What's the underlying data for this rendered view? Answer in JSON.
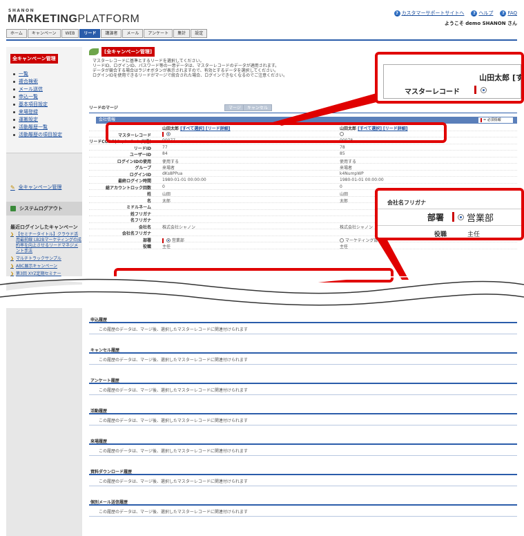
{
  "header": {
    "brand_small": "SHANON",
    "brand_main_1": "MARKETING",
    "brand_main_2": "PLATFORM",
    "support_link": "カスタマーサポートサイトへ",
    "help_link": "ヘルプ",
    "faq_link": "FAQ",
    "welcome": "ようこそ demo SHANON さん"
  },
  "nav": {
    "tabs": [
      "ホーム",
      "キャンペーン",
      "WEB",
      "リード",
      "講演者",
      "メール",
      "アンケート",
      "集計",
      "設定"
    ],
    "active": "リード"
  },
  "sidebar": {
    "heading": "全キャンペーン管理",
    "items": [
      "一覧",
      "複合検索",
      "メール送信",
      "申込一覧",
      "基本項目設定",
      "来場登録",
      "運搬設定",
      "活動履歴一覧",
      "活動履歴の項目設定"
    ],
    "all_campaigns": "全キャンペーン管理",
    "logout": "システムログアウト",
    "recent_heading": "最近ログインしたキャンペーン",
    "recent_items": [
      "【セミナータイトル】クラウド活用最前線 LB2Bマーケティングの成約率を向上させるリードマネジメント手法",
      "マルチトラックサンプル",
      "ABC展示キャンペーン",
      "第3回 XYZ定期セミナー"
    ]
  },
  "main": {
    "title": "[全キャンペーン管理]",
    "desc_lines": [
      "マスターレコードに基準とするリードを選択してください。",
      "リードID、ログインID、パスワード等の一意データは、マスターレコードのデータが適用されます。",
      "データが競合する場合はラジオボタンが表示されますので、有効とするデータを選択してください。",
      "ログインIDを使用できるリードがマージで統合された場合、ログインできなくなるのでご注意ください。"
    ],
    "merge_label": "リードのマージ",
    "merge_button": "マージ",
    "cancel_button": "キャンセル",
    "section_title": "会社情報",
    "required_note": "= 必須情報",
    "col_a_header": "山田太郎",
    "col_b_header": "山田太郎",
    "col_links": "[すべて選択] [リード詳細]",
    "rows": [
      {
        "k": "マスターレコード",
        "a": "",
        "b": ""
      },
      {
        "k": "リードCODE(キャンペーン共通)",
        "a": "00077",
        "b": "00078"
      },
      {
        "k": "リードID",
        "a": "77",
        "b": "78"
      },
      {
        "k": "ユーザーID",
        "a": "84",
        "b": "85"
      },
      {
        "k": "ログインIDの使用",
        "a": "使用する",
        "b": "使用する"
      },
      {
        "k": "グループ",
        "a": "来場者",
        "b": "来場者"
      },
      {
        "k": "ログインID",
        "a": "dKs8PPua",
        "b": "k4NumpWP"
      },
      {
        "k": "最終ログイン時間",
        "a": "1980-01-01 00:00:00",
        "b": "1980-01-01 00:00:00"
      },
      {
        "k": "総アカウントロック回数",
        "a": "0",
        "b": "0"
      },
      {
        "k": "姓",
        "a": "山田",
        "b": "山田"
      },
      {
        "k": "名",
        "a": "太郎",
        "b": "太郎"
      },
      {
        "k": "ミドルネーム",
        "a": "",
        "b": ""
      },
      {
        "k": "姓フリガナ",
        "a": "",
        "b": ""
      },
      {
        "k": "名フリガナ",
        "a": "",
        "b": ""
      },
      {
        "k": "会社名",
        "a": "株式会社シャノン",
        "b": "株式会社シャノン"
      },
      {
        "k": "会社名フリガナ",
        "a": "",
        "b": ""
      },
      {
        "k": "部署",
        "a": "営業部",
        "b": "マーケティング部"
      },
      {
        "k": "役職",
        "a": "主任",
        "b": "主任"
      }
    ],
    "zoom1_name": "山田太郎 [す",
    "zoom1_label": "マスターレコード",
    "zoom2_prev": "会社名フリガナ",
    "zoom2_label": "部署",
    "zoom2_value": "営業部",
    "zoom2_next": "役職",
    "zoom2_next_val": "主任"
  },
  "history": [
    {
      "title": "申込履歴",
      "text": "この履歴のデータは、マージ後、選択したマスターレコードに関連付けられます"
    },
    {
      "title": "キャンセル履歴",
      "text": "この履歴のデータは、マージ後、選択したマスターレコードに関連付けられます"
    },
    {
      "title": "アンケート履歴",
      "text": "この履歴のデータは、マージ後、選択したマスターレコードに関連付けられます"
    },
    {
      "title": "活動履歴",
      "text": "この履歴のデータは、マージ後、選択したマスターレコードに関連付けられます"
    },
    {
      "title": "来場履歴",
      "text": "この履歴のデータは、マージ後、選択したマスターレコードに関連付けられます"
    },
    {
      "title": "資料ダウンロード履歴",
      "text": "この履歴のデータは、マージ後、選択したマスターレコードに関連付けられます"
    },
    {
      "title": "個別メール送信履歴",
      "text": "この履歴のデータは、マージ後、選択したマスターレコードに関連付けられます"
    }
  ],
  "colors": {
    "accent": "#2a5caa",
    "highlight": "#e00000",
    "sidebar_head": "#cc0000"
  }
}
